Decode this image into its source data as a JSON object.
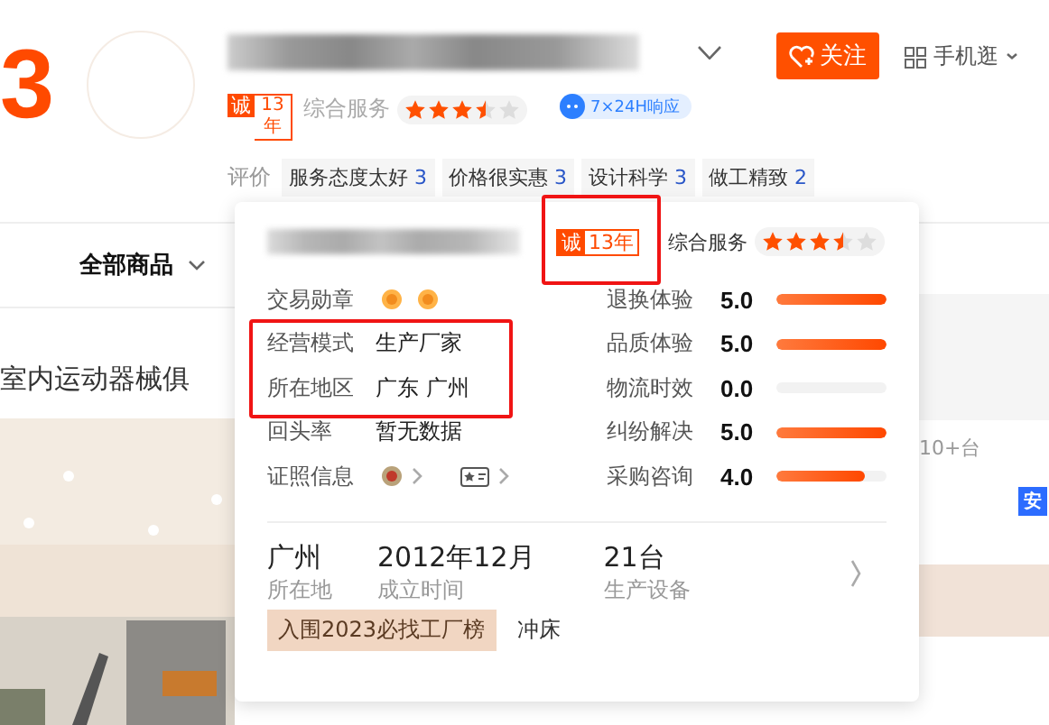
{
  "brand_digit": "3",
  "shop": {
    "follow_label": "关注",
    "mobile_label": "手机逛",
    "badge": {
      "prefix": "诚",
      "years": "13年"
    },
    "service_label": "综合服务",
    "stars": 3.5,
    "response_badge": "7×24H响应",
    "reviews_label": "评价",
    "review_tags": [
      {
        "text": "服务态度太好",
        "count": "3"
      },
      {
        "text": "价格很实惠",
        "count": "3"
      },
      {
        "text": "设计科学",
        "count": "3"
      },
      {
        "text": "做工精致",
        "count": "2"
      }
    ]
  },
  "nav": {
    "all_products": "全部商品"
  },
  "section_title": "室内运动器械俱",
  "behind": {
    "stock_text": "10+台",
    "badge": "安"
  },
  "popup": {
    "badge": {
      "prefix": "诚",
      "years": "13年"
    },
    "service_label": "综合服务",
    "stars": 3.5,
    "info": [
      {
        "label": "交易勋章",
        "kind": "medals"
      },
      {
        "label": "经营模式",
        "kind": "text",
        "value": "生产厂家"
      },
      {
        "label": "所在地区",
        "kind": "text",
        "value": "广东 广州"
      },
      {
        "label": "回头率",
        "kind": "text",
        "value": "暂无数据"
      },
      {
        "label": "证照信息",
        "kind": "licenses"
      }
    ],
    "scores": [
      {
        "label": "退换体验",
        "value": "5.0",
        "level": 1
      },
      {
        "label": "品质体验",
        "value": "5.0",
        "level": 1
      },
      {
        "label": "物流时效",
        "value": "0.0",
        "level": 0
      },
      {
        "label": "纠纷解决",
        "value": "5.0",
        "level": 1
      },
      {
        "label": "采购咨询",
        "value": "4.0",
        "level": 0.8
      }
    ],
    "facts": [
      {
        "value": "广州",
        "label": "所在地"
      },
      {
        "value": "2012年12月",
        "label": "成立时间"
      },
      {
        "value": "21台",
        "label": "生产设备"
      }
    ],
    "tags": [
      {
        "text": "入围2023必找工厂榜",
        "kind": "award"
      },
      {
        "text": "冲床",
        "kind": "plain"
      }
    ]
  }
}
